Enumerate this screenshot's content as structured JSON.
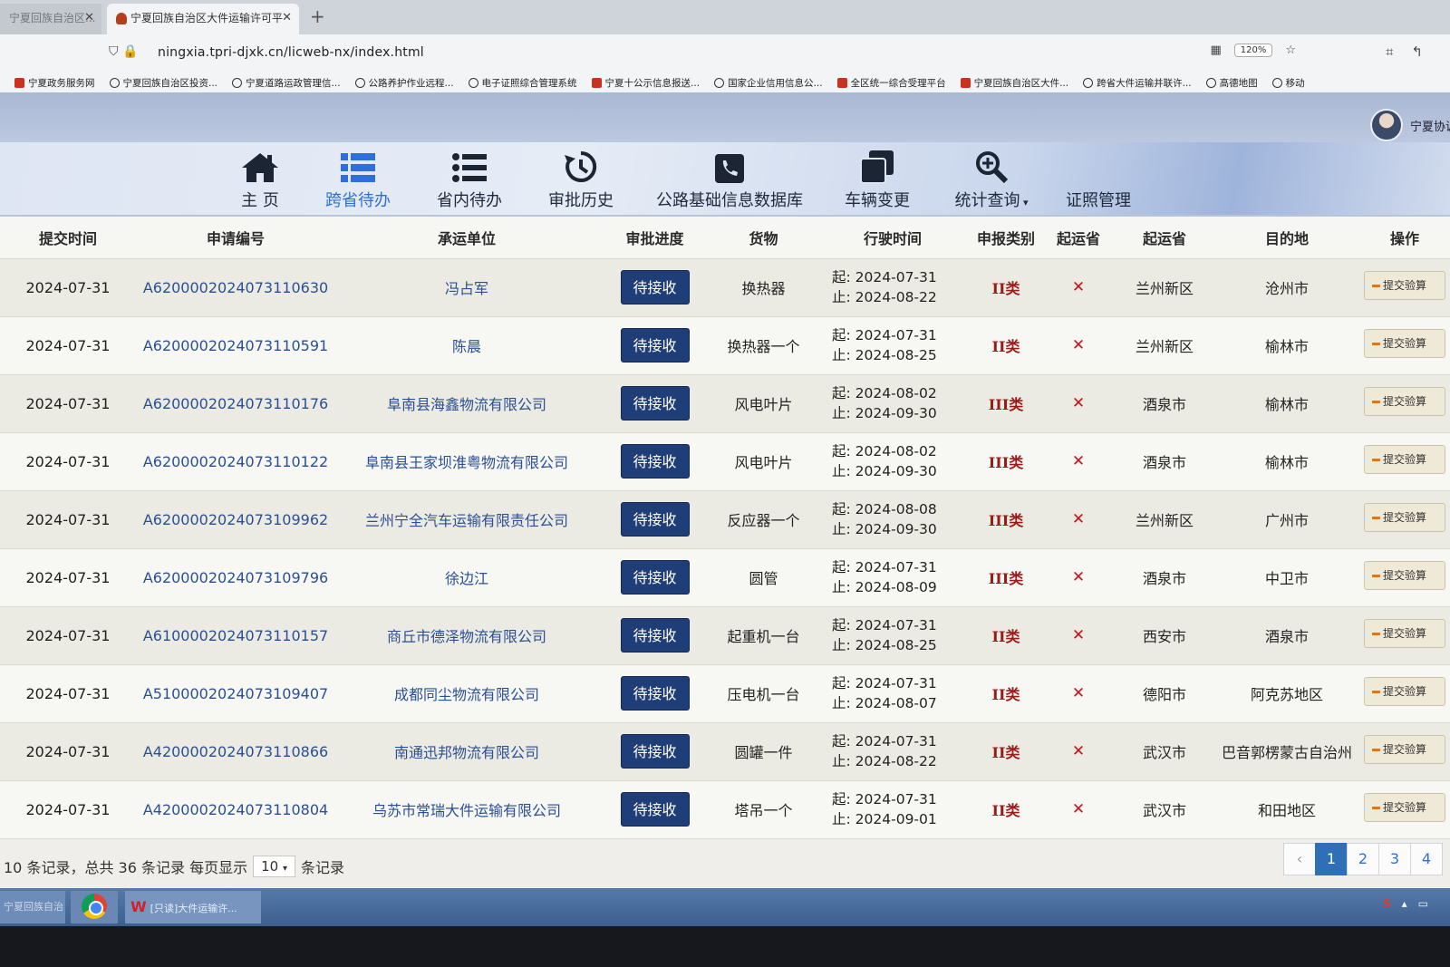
{
  "browser": {
    "inactive_tab": "宁夏回族自治区...",
    "active_tab": "宁夏回族自治区大件运输许可平",
    "url": "ningxia.tpri-djxk.cn/licweb-nx/index.html",
    "zoom": "120%",
    "bookmarks": [
      {
        "label": "宁夏政务服务网",
        "icon": "red"
      },
      {
        "label": "宁夏回族自治区投资...",
        "icon": "globe"
      },
      {
        "label": "宁夏道路运政管理信...",
        "icon": "globe"
      },
      {
        "label": "公路养护作业远程...",
        "icon": "globe"
      },
      {
        "label": "电子证照综合管理系统",
        "icon": "globe"
      },
      {
        "label": "宁夏十公示信息报送...",
        "icon": "red"
      },
      {
        "label": "国家企业信用信息公...",
        "icon": "globe"
      },
      {
        "label": "全区统一综合受理平台",
        "icon": "red"
      },
      {
        "label": "宁夏回族自治区大件...",
        "icon": "red"
      },
      {
        "label": "跨省大件运输并联许...",
        "icon": "globe"
      },
      {
        "label": "高德地图",
        "icon": "globe"
      },
      {
        "label": "移动",
        "icon": "globe"
      }
    ]
  },
  "user": {
    "name": "宁夏协调"
  },
  "nav": [
    {
      "label": "主 页",
      "icon": "home-icon"
    },
    {
      "label": "跨省待办",
      "icon": "grid-list-icon",
      "active": true
    },
    {
      "label": "省内待办",
      "icon": "list-icon"
    },
    {
      "label": "审批历史",
      "icon": "history-icon"
    },
    {
      "label": "公路基础信息数据库",
      "icon": "phone-icon"
    },
    {
      "label": "车辆变更",
      "icon": "copy-icon"
    },
    {
      "label": "统计查询",
      "icon": "zoom-icon",
      "dropdown": true
    },
    {
      "label": "证照管理",
      "icon": "none"
    }
  ],
  "table": {
    "headers": [
      "提交时间",
      "申请编号",
      "承运单位",
      "审批进度",
      "货物",
      "行驶时间",
      "申报类别",
      "起运省",
      "起运省",
      "目的地",
      "操作"
    ],
    "status_label": "待接收",
    "start_prefix": "起:",
    "end_prefix": "止:",
    "action_label": "提交验算",
    "rows": [
      {
        "date": "2024-07-31",
        "id": "A6200002024073110630",
        "unit": "冯占军",
        "cargo": "换热器",
        "start": "2024-07-31",
        "end": "2024-08-22",
        "type": "II类",
        "origin": "兰州新区",
        "dest": "沧州市"
      },
      {
        "date": "2024-07-31",
        "id": "A6200002024073110591",
        "unit": "陈晨",
        "cargo": "换热器一个",
        "start": "2024-07-31",
        "end": "2024-08-25",
        "type": "II类",
        "origin": "兰州新区",
        "dest": "榆林市"
      },
      {
        "date": "2024-07-31",
        "id": "A6200002024073110176",
        "unit": "阜南县海鑫物流有限公司",
        "cargo": "风电叶片",
        "start": "2024-08-02",
        "end": "2024-09-30",
        "type": "III类",
        "origin": "酒泉市",
        "dest": "榆林市"
      },
      {
        "date": "2024-07-31",
        "id": "A6200002024073110122",
        "unit": "阜南县王家坝淮粤物流有限公司",
        "cargo": "风电叶片",
        "start": "2024-08-02",
        "end": "2024-09-30",
        "type": "III类",
        "origin": "酒泉市",
        "dest": "榆林市"
      },
      {
        "date": "2024-07-31",
        "id": "A6200002024073109962",
        "unit": "兰州宁全汽车运输有限责任公司",
        "cargo": "反应器一个",
        "start": "2024-08-08",
        "end": "2024-09-30",
        "type": "III类",
        "origin": "兰州新区",
        "dest": "广州市"
      },
      {
        "date": "2024-07-31",
        "id": "A6200002024073109796",
        "unit": "徐边江",
        "cargo": "圆管",
        "start": "2024-07-31",
        "end": "2024-08-09",
        "type": "III类",
        "origin": "酒泉市",
        "dest": "中卫市"
      },
      {
        "date": "2024-07-31",
        "id": "A6100002024073110157",
        "unit": "商丘市德泽物流有限公司",
        "cargo": "起重机一台",
        "start": "2024-07-31",
        "end": "2024-08-25",
        "type": "II类",
        "origin": "西安市",
        "dest": "酒泉市"
      },
      {
        "date": "2024-07-31",
        "id": "A5100002024073109407",
        "unit": "成都同尘物流有限公司",
        "cargo": "压电机一台",
        "start": "2024-07-31",
        "end": "2024-08-07",
        "type": "II类",
        "origin": "德阳市",
        "dest": "阿克苏地区"
      },
      {
        "date": "2024-07-31",
        "id": "A4200002024073110866",
        "unit": "南通迅邦物流有限公司",
        "cargo": "圆罐一件",
        "start": "2024-07-31",
        "end": "2024-08-22",
        "type": "II类",
        "origin": "武汉市",
        "dest": "巴音郭楞蒙古自治州"
      },
      {
        "date": "2024-07-31",
        "id": "A4200002024073110804",
        "unit": "乌苏市常瑞大件运输有限公司",
        "cargo": "塔吊一个",
        "start": "2024-07-31",
        "end": "2024-09-01",
        "type": "II类",
        "origin": "武汉市",
        "dest": "和田地区"
      }
    ]
  },
  "pager": {
    "summary": "10 条记录，总共 36 条记录 每页显示",
    "page_size": "10",
    "suffix": "条记录",
    "prev": "‹",
    "pages": [
      "1",
      "2",
      "3",
      "4"
    ],
    "current": "1"
  },
  "taskbar": {
    "start_label": "宁夏回族自治区...",
    "wps_label": "[只读]大件运输许...",
    "wps_icon": "W"
  }
}
